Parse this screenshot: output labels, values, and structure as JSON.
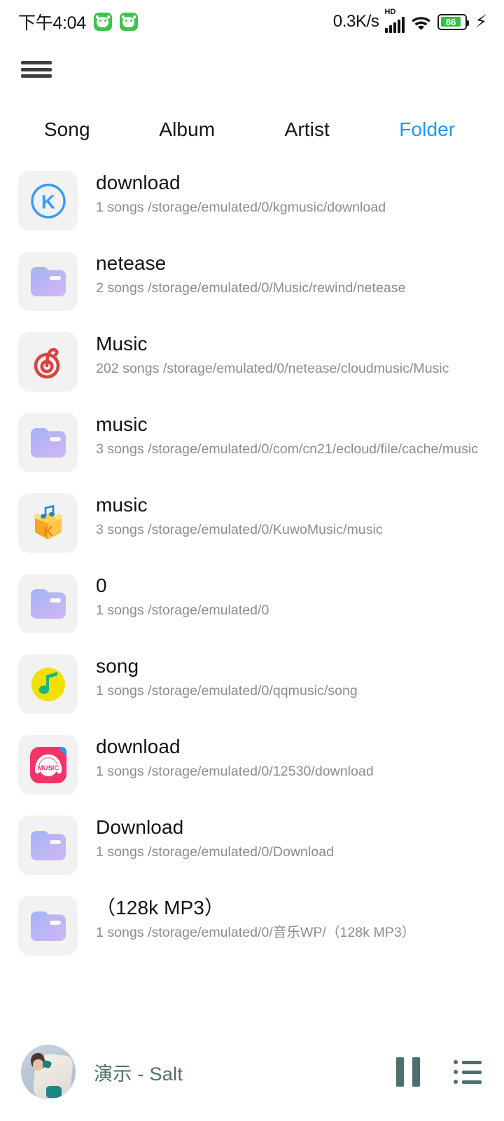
{
  "statusbar": {
    "clock": "下午4:04",
    "app_badges": [
      "android-badge-icon",
      "android-badge-icon"
    ],
    "net_speed": "0.3K/s",
    "hd_label": "HD",
    "signal_icon": "signal-bars-icon",
    "wifi_icon": "wifi-icon",
    "battery_level": "86",
    "charging_icon": "lightning-bolt-icon"
  },
  "header": {
    "menu_icon": "hamburger-menu-icon"
  },
  "tabs": [
    {
      "label": "Song",
      "active": false
    },
    {
      "label": "Album",
      "active": false
    },
    {
      "label": "Artist",
      "active": false
    },
    {
      "label": "Folder",
      "active": true
    }
  ],
  "colors": {
    "accent": "#2196f3",
    "title": "#121212",
    "subtitle": "#8c8c8c",
    "player_text": "#4e6f6d",
    "thumb_bg": "#f2f2f2",
    "battery_green": "#35c03c"
  },
  "folders": [
    {
      "icon": "kugou-music-icon",
      "name": "download",
      "count": "1 songs",
      "path": "/storage/emulated/0/kgmusic/download",
      "subtitle": "1 songs /storage/emulated/0/kgmusic/download"
    },
    {
      "icon": "folder-icon",
      "name": "netease",
      "count": "2 songs",
      "path": "/storage/emulated/0/Music/rewind/netease",
      "subtitle": "2 songs /storage/emulated/0/Music/rewind/netease"
    },
    {
      "icon": "netease-cloud-music-icon",
      "name": "Music",
      "count": "202 songs",
      "path": "/storage/emulated/0/netease/cloudmusic/Music",
      "subtitle": "202 songs /storage/emulated/0/netease/cloudmusic/Music"
    },
    {
      "icon": "folder-icon",
      "name": "music",
      "count": "3 songs",
      "path": "/storage/emulated/0/com/cn21/ecloud/file/cache/music",
      "subtitle": "3 songs /storage/emulated/0/com/cn21/ecloud/file/cache/music"
    },
    {
      "icon": "kuwo-music-icon",
      "name": "music",
      "count": "3 songs",
      "path": "/storage/emulated/0/KuwoMusic/music",
      "subtitle": "3 songs /storage/emulated/0/KuwoMusic/music"
    },
    {
      "icon": "folder-icon",
      "name": "0",
      "count": "1 songs",
      "path": "/storage/emulated/0",
      "subtitle": "1 songs /storage/emulated/0"
    },
    {
      "icon": "qq-music-icon",
      "name": "song",
      "count": "1 songs",
      "path": "/storage/emulated/0/qqmusic/song",
      "subtitle": "1 songs /storage/emulated/0/qqmusic/song"
    },
    {
      "icon": "migu-music-icon",
      "name": "download",
      "count": "1 songs",
      "path": "/storage/emulated/0/12530/download",
      "subtitle": "1 songs /storage/emulated/0/12530/download"
    },
    {
      "icon": "folder-icon",
      "name": "Download",
      "count": "1 songs",
      "path": "/storage/emulated/0/Download",
      "subtitle": "1 songs /storage/emulated/0/Download"
    },
    {
      "icon": "folder-icon",
      "name": "（128k MP3）",
      "count": "1 songs",
      "path": "/storage/emulated/0/音乐WP/（128k MP3）",
      "subtitle": "1 songs /storage/emulated/0/音乐WP/（128k MP3）"
    }
  ],
  "player": {
    "album_art": "album-art-thumbnail",
    "now_playing": "演示 - Salt",
    "pause_icon": "pause-icon",
    "playlist_icon": "playlist-queue-icon"
  }
}
